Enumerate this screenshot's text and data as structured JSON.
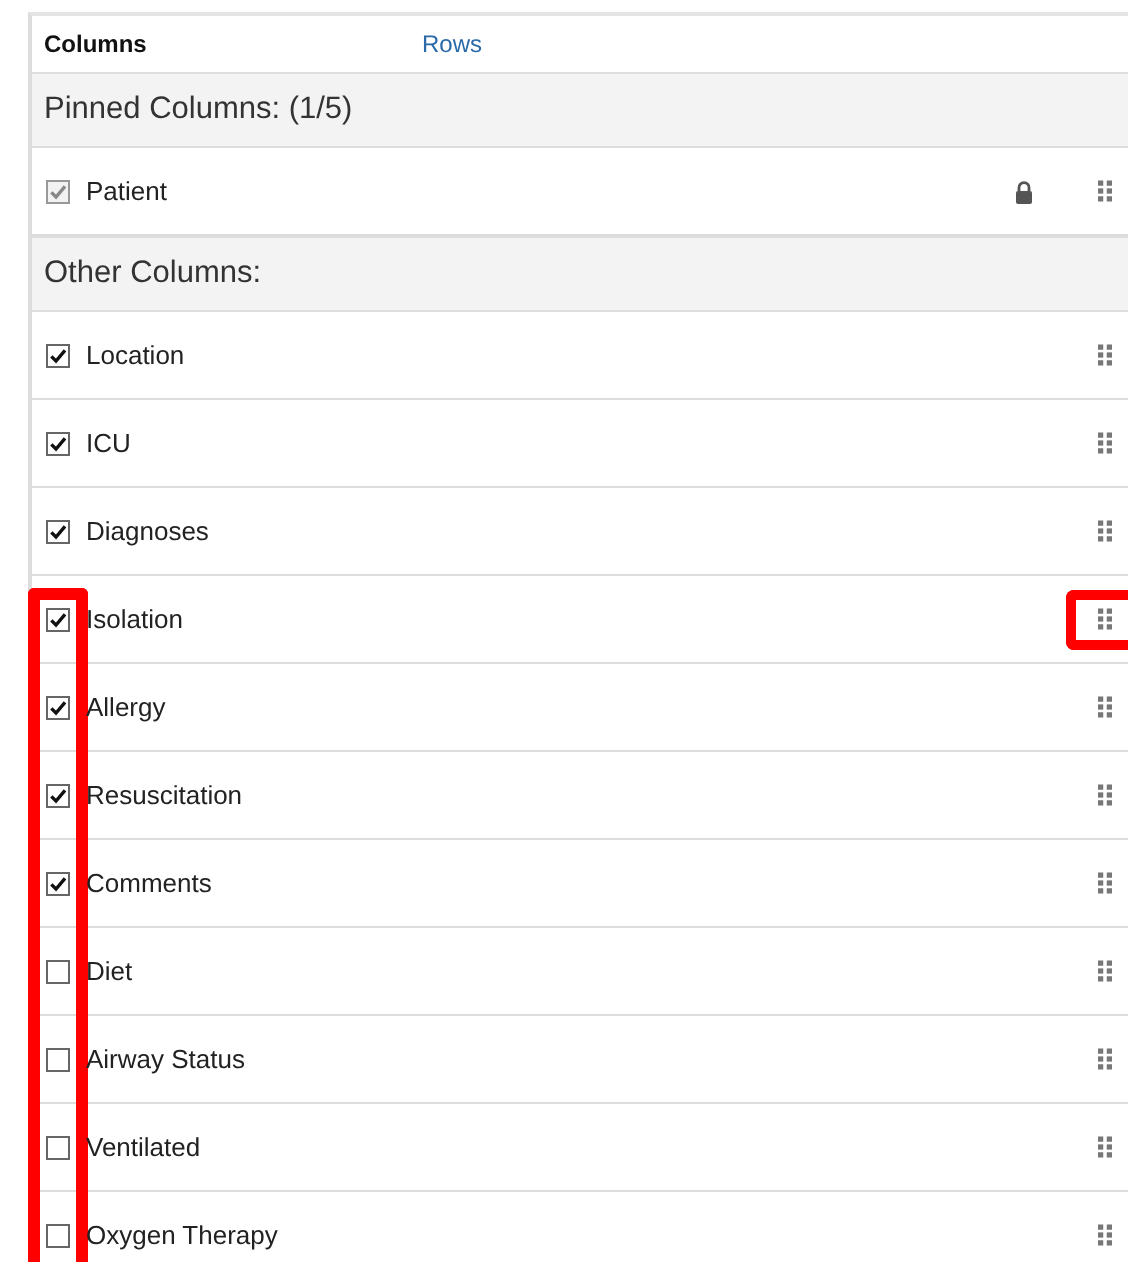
{
  "tabs": [
    {
      "label": "Columns",
      "selected": true
    },
    {
      "label": "Rows",
      "selected": false
    }
  ],
  "sections": [
    {
      "title": "Pinned Columns: (1/5)",
      "items": [
        {
          "label": "Patient",
          "checked": true,
          "disabled": true,
          "locked": true,
          "checkbox_outlined": false,
          "handle_outlined": false
        }
      ]
    },
    {
      "title": "Other Columns:",
      "items": [
        {
          "label": "Location",
          "checked": true,
          "disabled": false,
          "checkbox_outlined": false,
          "handle_outlined": false
        },
        {
          "label": "ICU",
          "checked": true,
          "disabled": false,
          "checkbox_outlined": false,
          "handle_outlined": false
        },
        {
          "label": "Diagnoses",
          "checked": true,
          "disabled": false,
          "checkbox_outlined": false,
          "handle_outlined": false
        },
        {
          "label": "Isolation",
          "checked": true,
          "disabled": false,
          "checkbox_outlined": true,
          "handle_outlined": true
        },
        {
          "label": "Allergy",
          "checked": true,
          "disabled": false,
          "checkbox_outlined": true,
          "handle_outlined": false
        },
        {
          "label": "Resuscitation",
          "checked": true,
          "disabled": false,
          "checkbox_outlined": true,
          "handle_outlined": false
        },
        {
          "label": "Comments",
          "checked": true,
          "disabled": false,
          "checkbox_outlined": true,
          "handle_outlined": false
        },
        {
          "label": "Diet",
          "checked": false,
          "disabled": false,
          "checkbox_outlined": true,
          "handle_outlined": false
        },
        {
          "label": "Airway Status",
          "checked": false,
          "disabled": false,
          "checkbox_outlined": true,
          "handle_outlined": false
        },
        {
          "label": "Ventilated",
          "checked": false,
          "disabled": false,
          "checkbox_outlined": true,
          "handle_outlined": false
        },
        {
          "label": "Oxygen Therapy",
          "checked": false,
          "disabled": false,
          "checkbox_outlined": true,
          "handle_outlined": false
        }
      ]
    }
  ]
}
